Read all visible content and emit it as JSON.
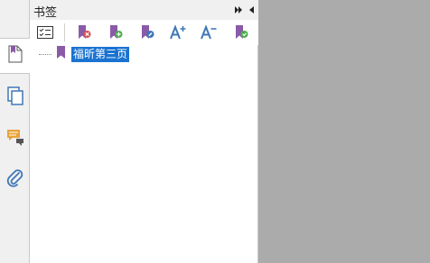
{
  "panel": {
    "title": "书签"
  },
  "bookmarks": [
    {
      "label": "福昕第三页"
    }
  ],
  "side_tabs": [
    {
      "name": "bookmarks-tab",
      "icon": "bookmark-page-icon",
      "active": true
    },
    {
      "name": "pages-tab",
      "icon": "pages-icon",
      "active": false
    },
    {
      "name": "comments-tab",
      "icon": "comments-icon",
      "active": false
    },
    {
      "name": "attachments-tab",
      "icon": "paperclip-icon",
      "active": false
    }
  ],
  "toolbar": [
    {
      "name": "expand-bookmark-button",
      "icon": "list-check-icon"
    },
    {
      "name": "delete-bookmark-button",
      "icon": "bookmark-delete-icon"
    },
    {
      "name": "add-bookmark-button",
      "icon": "bookmark-add-icon"
    },
    {
      "name": "bookmark-properties-button",
      "icon": "bookmark-edit-icon"
    },
    {
      "name": "increase-font-button",
      "icon": "font-increase-icon"
    },
    {
      "name": "decrease-font-button",
      "icon": "font-decrease-icon"
    },
    {
      "name": "find-bookmark-button",
      "icon": "bookmark-find-icon"
    }
  ],
  "colors": {
    "accent": "#1a73d1",
    "bookmark_purple": "#8a5aa8",
    "icon_blue": "#3f77b7",
    "comment_orange": "#e8a33a"
  }
}
